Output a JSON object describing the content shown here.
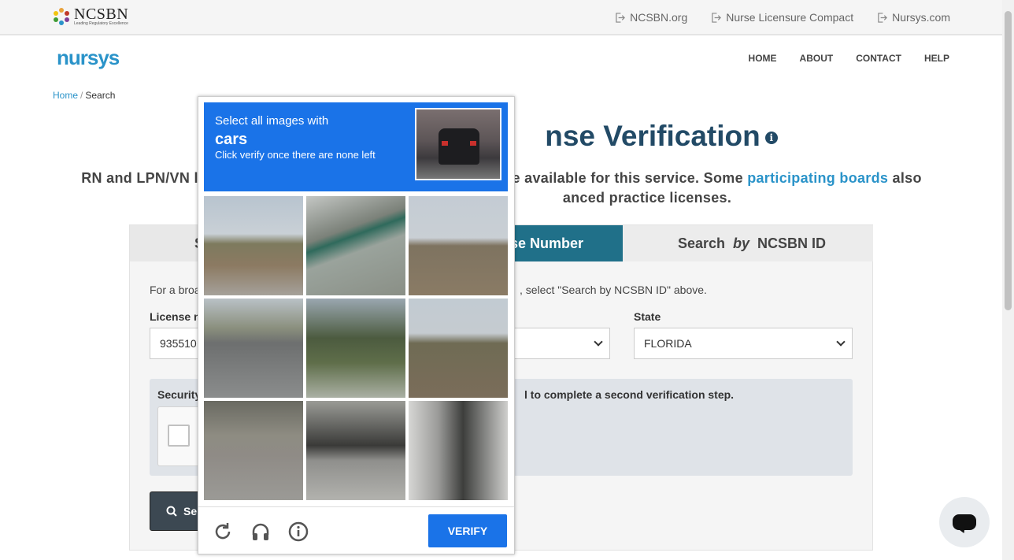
{
  "topbar": {
    "logo_word": "NCSBN",
    "logo_tagline": "Leading Regulatory Excellence",
    "links": [
      "NCSBN.org",
      "Nurse Licensure Compact",
      "Nursys.com"
    ]
  },
  "nav": {
    "logo": "nursys",
    "items": [
      "HOME",
      "ABOUT",
      "CONTACT",
      "HELP"
    ]
  },
  "breadcrumb": {
    "home": "Home",
    "current": "Search"
  },
  "page": {
    "title_visible": "nse Verification",
    "intro_left": "RN and LPN/VN lic",
    "intro_right": "re available for this service. Some ",
    "intro_link": "participating boards",
    "intro_end": " also",
    "intro_line2": "anced practice licenses."
  },
  "tabs": {
    "name_partial": "S",
    "license_partial": "nse Number",
    "id_prefix": "Search ",
    "id_by": "by",
    "id_suffix": " NCSBN ID"
  },
  "form": {
    "help_left": "For a broa",
    "help_right": ", select \"Search by NCSBN ID\" above.",
    "license_label": "License n",
    "license_value": "935510",
    "state_label": "State",
    "state_value": "FLORIDA",
    "security_label": "Security",
    "security_note": "l to complete a second verification step.",
    "search_label": "Se"
  },
  "captcha": {
    "instruction": "Select all images with",
    "target": "cars",
    "subtext": "Click verify once there are none left",
    "verify_label": "VERIFY",
    "icons": [
      "reload-icon",
      "headphones-icon",
      "info-icon"
    ],
    "tiles": [
      "houses-street",
      "overpass",
      "dirt-lot",
      "highway-road",
      "palm-trees",
      "overpass-field",
      "street-under-bridge",
      "highway-truck",
      "motorcycles-snow"
    ]
  },
  "colors": {
    "brand_dark": "#224a66",
    "brand_link": "#2a93c9",
    "tab_active": "#207089",
    "captcha_blue": "#1a73e8"
  }
}
